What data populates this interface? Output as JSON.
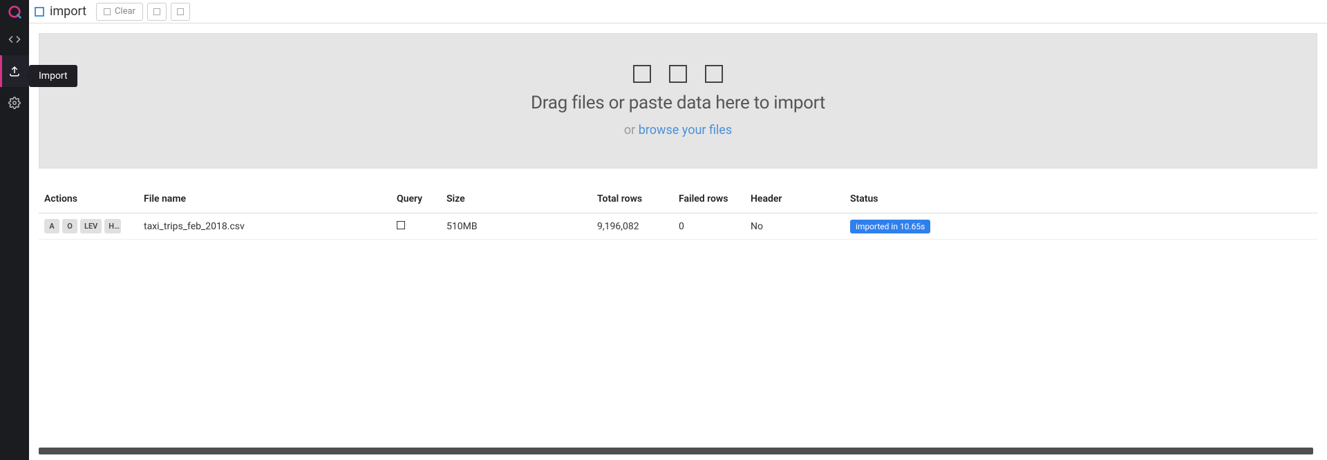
{
  "page_title": "import",
  "toolbar": {
    "clear_label": "Clear"
  },
  "sidebar": {
    "tooltip": "Import"
  },
  "dropzone": {
    "heading": "Drag files or paste data here to import",
    "sub_prefix": "or ",
    "browse": "browse your files"
  },
  "table": {
    "headers": {
      "actions": "Actions",
      "file": "File name",
      "query": "Query",
      "size": "Size",
      "total": "Total rows",
      "failed": "Failed rows",
      "header_col": "Header",
      "status": "Status"
    },
    "rows": [
      {
        "actions": [
          "A",
          "O",
          "LEV",
          "H…"
        ],
        "file": "taxi_trips_feb_2018.csv",
        "size": "510MB",
        "total": "9,196,082",
        "failed": "0",
        "header": "No",
        "status": "imported in 10.65s"
      }
    ]
  }
}
